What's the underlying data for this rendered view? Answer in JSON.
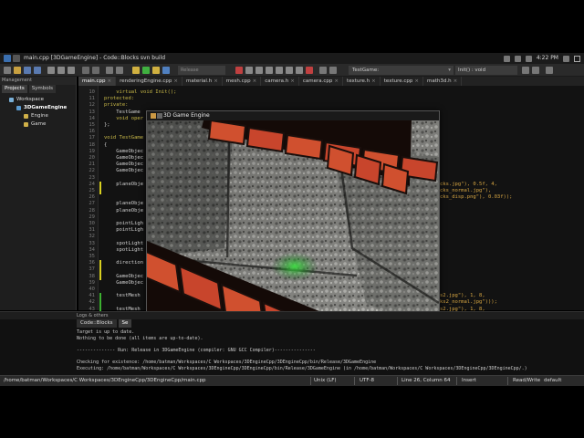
{
  "window": {
    "title": "main.cpp [3DGameEngine] - Code::Blocks svn build"
  },
  "system_tray": {
    "clock": "4:22 PM"
  },
  "toolbar": {
    "build_target": "Release",
    "scope_combo": "TestGame:",
    "function_combo": "Init() : void"
  },
  "management": {
    "title": "Management",
    "tabs": [
      {
        "label": "Projects"
      },
      {
        "label": "Symbols"
      }
    ],
    "tree": [
      {
        "label": "Workspace"
      },
      {
        "label": "3DGameEngine"
      },
      {
        "label": "Engine"
      },
      {
        "label": "Game"
      }
    ]
  },
  "editor": {
    "tabs": [
      {
        "label": "main.cpp"
      },
      {
        "label": "renderingEngine.cpp"
      },
      {
        "label": "material.h"
      },
      {
        "label": "mesh.cpp"
      },
      {
        "label": "camera.h"
      },
      {
        "label": "camera.cpp"
      },
      {
        "label": "texture.h"
      },
      {
        "label": "texture.cpp"
      },
      {
        "label": "math3d.h"
      }
    ],
    "line_numbers": [
      "10",
      "11",
      "12",
      "13",
      "14",
      "15",
      "16",
      "17",
      "18",
      "19",
      "20",
      "21",
      "22",
      "23",
      "24",
      "25",
      "26",
      "27",
      "28",
      "29",
      "30",
      "31",
      "32",
      "33",
      "34",
      "35",
      "36",
      "37",
      "38",
      "39",
      "40",
      "41",
      "42",
      "43",
      "44"
    ],
    "code": [
      {
        "parts": [
          {
            "t": "    virtual void Init();",
            "c": "kw"
          }
        ]
      },
      {
        "parts": [
          {
            "t": "protected:",
            "c": "kw"
          }
        ]
      },
      {
        "parts": [
          {
            "t": "private:",
            "c": "kw"
          }
        ]
      },
      {
        "parts": [
          {
            "t": "    TestGame",
            "c": "id"
          }
        ]
      },
      {
        "parts": [
          {
            "t": "    void oper",
            "c": "kw"
          }
        ]
      },
      {
        "parts": [
          {
            "t": "};",
            "c": "id"
          }
        ]
      },
      {
        "parts": [
          {
            "t": "",
            "c": "id"
          }
        ]
      },
      {
        "parts": [
          {
            "t": "void TestGame",
            "c": "kw"
          }
        ]
      },
      {
        "parts": [
          {
            "t": "{",
            "c": "id"
          }
        ]
      },
      {
        "parts": [
          {
            "t": "    GameObjec",
            "c": "id"
          }
        ]
      },
      {
        "parts": [
          {
            "t": "    GameObjec",
            "c": "id"
          }
        ]
      },
      {
        "parts": [
          {
            "t": "    GameObjec",
            "c": "id"
          }
        ]
      },
      {
        "parts": [
          {
            "t": "    GameObjec",
            "c": "id"
          }
        ]
      },
      {
        "parts": [
          {
            "t": "",
            "c": "id"
          }
        ]
      },
      {
        "parts": [
          {
            "t": "    planeObje",
            "c": "id"
          }
        ]
      },
      {
        "parts": [
          {
            "t": "",
            "c": "id"
          }
        ]
      },
      {
        "parts": [
          {
            "t": "",
            "c": "id"
          }
        ]
      },
      {
        "parts": [
          {
            "t": "    planeObje",
            "c": "id"
          }
        ]
      },
      {
        "parts": [
          {
            "t": "    planeObje",
            "c": "id"
          }
        ]
      },
      {
        "parts": [
          {
            "t": "",
            "c": "id"
          }
        ]
      },
      {
        "parts": [
          {
            "t": "    pointLigh",
            "c": "id"
          }
        ]
      },
      {
        "parts": [
          {
            "t": "    pointLigh",
            "c": "id"
          }
        ]
      },
      {
        "parts": [
          {
            "t": "",
            "c": "id"
          }
        ]
      },
      {
        "parts": [
          {
            "t": "    spotLight",
            "c": "id"
          }
        ]
      },
      {
        "parts": [
          {
            "t": "    spotLight",
            "c": "id"
          }
        ]
      },
      {
        "parts": [
          {
            "t": "",
            "c": "id"
          }
        ]
      },
      {
        "parts": [
          {
            "t": "    direction",
            "c": "id"
          }
        ]
      },
      {
        "parts": [
          {
            "t": "",
            "c": "id"
          }
        ]
      },
      {
        "parts": [
          {
            "t": "    GameObjec",
            "c": "id"
          }
        ]
      },
      {
        "parts": [
          {
            "t": "    GameObjec",
            "c": "id"
          }
        ]
      },
      {
        "parts": [
          {
            "t": "",
            "c": "id"
          }
        ]
      },
      {
        "parts": [
          {
            "t": "    testMesh",
            "c": "id"
          }
        ]
      },
      {
        "parts": [
          {
            "t": "",
            "c": "id"
          }
        ]
      },
      {
        "parts": [
          {
            "t": "    testMesh",
            "c": "id"
          }
        ]
      },
      {
        "parts": [
          {
            "t": "",
            "c": "id"
          }
        ]
      }
    ],
    "code_tails": [
      {
        "line_index": 14,
        "text": "cks.jpg\"), 0.5f, 4,"
      },
      {
        "line_index": 15,
        "text": "cks_normal.jpg\"),"
      },
      {
        "line_index": 16,
        "text": "cks_disp.png\"), 0.03f));"
      },
      {
        "line_index": 31,
        "text": "s2.jpg\"), 1, 8,"
      },
      {
        "line_index": 32,
        "text": "ks2_normal.jpg\")));"
      },
      {
        "line_index": 33,
        "text": "s2.jpg\"), 1, 8,"
      },
      {
        "line_index": 34,
        "text": "ks2_normal.jpg\")));"
      }
    ]
  },
  "logs": {
    "title": "Logs & others",
    "tabs": [
      {
        "label": "Code::Blocks"
      },
      {
        "label": "Se"
      }
    ],
    "lines": [
      "Target is up to date.",
      "Nothing to be done (all items are up-to-date).",
      "",
      "-------------- Run: Release in 3DGameEngine (compiler: GNU GCC Compiler)---------------",
      "",
      "Checking for existence: /home/batman/Workspaces/C Workspaces/3DEngineCpp/3DEngineCpp/bin/Release/3DGameEngine",
      "Executing: /home/batman/Workspaces/C Workspaces/3DEngineCpp/3DEngineCpp/bin/Release/3DGameEngine  (in /home/batman/Workspaces/C Workspaces/3DEngineCpp/3DEngineCpp/.)"
    ]
  },
  "statusbar": {
    "path": "/home/batman/Workspaces/C Workspaces/3DEngineCpp/3DEngineCpp/main.cpp",
    "line_endings": "Unix (LF)",
    "encoding": "UTF-8",
    "position": "Line 26, Column 64",
    "mode": "Insert",
    "access": "Read/Write",
    "profile": "default"
  },
  "game_window": {
    "title": "3D Game Engine"
  },
  "colors": {
    "brick": "#c8452c",
    "mortar": "#1a0f0c",
    "stone": "#8c8c88",
    "light": "#34d23a"
  }
}
